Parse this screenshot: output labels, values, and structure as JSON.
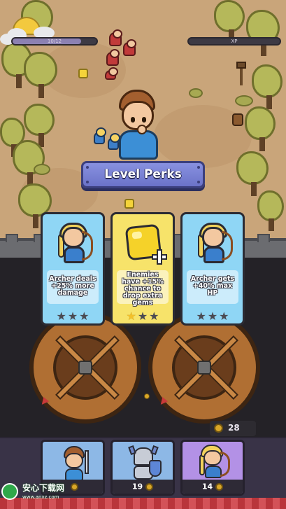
{
  "hud": {
    "health_text": "10/12",
    "health_fraction": 0.82,
    "xp_label": "XP",
    "xp_fraction": 0.0
  },
  "level_perks": {
    "title": "Level Perks",
    "cards": [
      {
        "description": "Archer deals +25% more damage",
        "stars_filled": 0,
        "stars_total": 3,
        "art": "archer-portrait",
        "bg": "#8fd6f5"
      },
      {
        "description": "Enemies have +15% chance to drop extra gems",
        "stars_filled": 1,
        "stars_total": 3,
        "art": "gem-plus-icon",
        "bg": "#f7e36a"
      },
      {
        "description": "Archer gets +40% max HP",
        "stars_filled": 0,
        "stars_total": 3,
        "art": "archer-portrait",
        "bg": "#8fd6f5"
      }
    ]
  },
  "currency": {
    "coins": "28"
  },
  "units": [
    {
      "name_icon": "swordsman-icon",
      "price": "",
      "bg": "#8db8e6"
    },
    {
      "name_icon": "knight-icon",
      "price": "19",
      "bg": "#8db8e6"
    },
    {
      "name_icon": "archer-icon",
      "price": "14",
      "bg": "#b391e6"
    }
  ],
  "watermark": {
    "text": "安心下载网",
    "url": "www.anxz.com"
  },
  "colors": {
    "accent": "#6b73c8",
    "star_on": "#f3c02a",
    "star_off": "#4a4a52",
    "coin": "#d9a728"
  }
}
